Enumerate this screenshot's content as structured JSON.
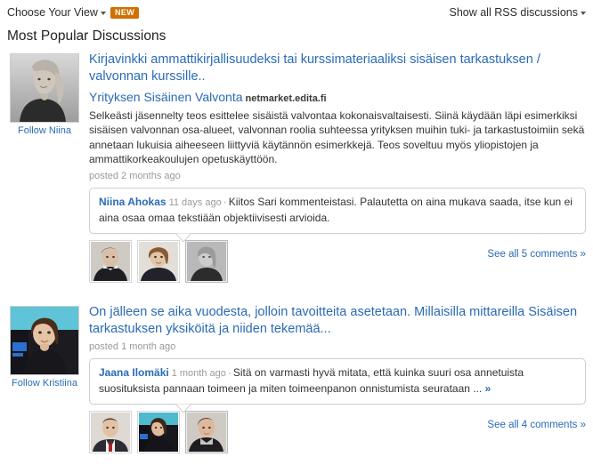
{
  "topbar": {
    "choose_view_label": "Choose Your View",
    "choose_view_caret": "caret-down-icon",
    "new_badge": "NEW",
    "show_rss_label": "Show all RSS discussions",
    "show_rss_caret": "caret-down-icon"
  },
  "section": {
    "title": "Most Popular Discussions"
  },
  "discussions": [
    {
      "follow_label": "Follow Niina",
      "avatar": "portrait-niina",
      "title": "Kirjavinkki ammattikirjallisuudeksi tai kurssimateriaaliksi sisäisen tarkastuksen / valvonnan kurssille..",
      "source_name": "Yrityksen Sisäinen Valvonta",
      "source_domain": "netmarket.edita.fi",
      "body": "Selkeästi jäsennelty teos esittelee sisäistä valvontaa kokonaisvaltaisesti. Siinä käydään läpi esimerkiksi sisäisen valvonnan osa-alueet, valvonnan roolia suhteessa yrityksen muihin tuki- ja tarkastustoimiin sekä annetaan lukuisia aiheeseen liittyviä käytännön esimerkkejä. Teos soveltuu myös yliopistojen ja ammattikorkeakoulujen opetuskäyttöön.",
      "posted": "posted 2 months ago",
      "comment": {
        "author": "Niina Ahokas",
        "time": "11 days ago",
        "separator": "·",
        "text": "Kiitos Sari kommenteistasi. Palautetta on aina mukava saada, itse kun ei aina osaa omaa tekstiään objektiivisesti arvioida.",
        "more": ""
      },
      "thumbs": [
        {
          "name": "commenter-thumb-1",
          "selected": false
        },
        {
          "name": "commenter-thumb-2",
          "selected": false
        },
        {
          "name": "commenter-thumb-3",
          "selected": true
        }
      ],
      "see_all": "See all 5 comments »"
    },
    {
      "follow_label": "Follow Kristiina",
      "avatar": "portrait-kristiina",
      "title": "On jälleen se aika vuodesta, jolloin tavoitteita asetetaan. Millaisilla mittareilla Sisäisen tarkastuksen yksiköitä ja niiden tekemää...",
      "source_name": "",
      "source_domain": "",
      "body": "",
      "posted": "posted 1 month ago",
      "comment": {
        "author": "Jaana Ilomäki",
        "time": "1 month ago",
        "separator": "·",
        "text": "Sitä on varmasti hyvä mitata, että kuinka suuri osa annetuista suosituksista pannaan toimeen ja miten toimeenpanon onnistumista seurataan ...",
        "more": "»"
      },
      "thumbs": [
        {
          "name": "commenter-thumb-1",
          "selected": false
        },
        {
          "name": "commenter-thumb-2",
          "selected": false
        },
        {
          "name": "commenter-thumb-3",
          "selected": true
        }
      ],
      "see_all": "See all 4 comments »"
    }
  ],
  "colors": {
    "link_blue": "#2a6bb5",
    "badge_orange": "#d07000",
    "muted_gray": "#9a9a9a",
    "text": "#333333",
    "border": "#cfcfcf"
  }
}
